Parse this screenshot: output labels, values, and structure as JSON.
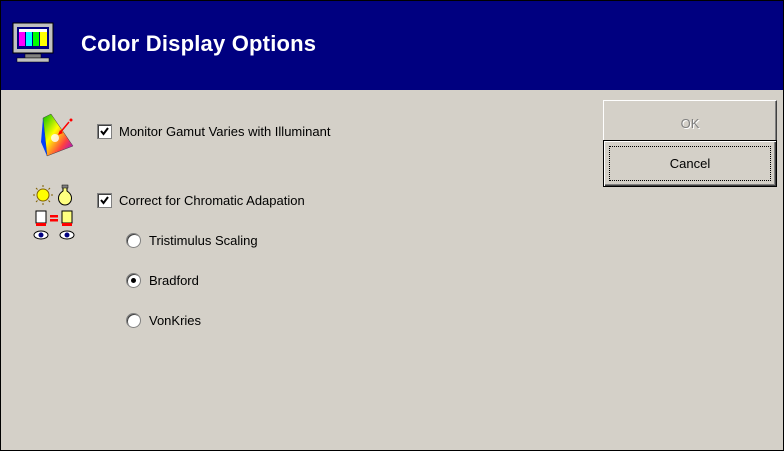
{
  "window": {
    "title": "Color Display Options"
  },
  "options": {
    "monitor_gamut": {
      "label": "Monitor Gamut Varies with Illuminant",
      "checked": true
    },
    "chromatic_adaptation": {
      "label": "Correct for Chromatic Adapation",
      "checked": true
    },
    "methods": [
      {
        "label": "Tristimulus Scaling",
        "selected": false
      },
      {
        "label": "Bradford",
        "selected": true
      },
      {
        "label": "VonKries",
        "selected": false
      }
    ]
  },
  "buttons": {
    "ok_label": "OK",
    "cancel_label": "Cancel"
  },
  "icons": {
    "title": "monitor-icon",
    "gamut": "chromaticity-diagram-icon",
    "adaptation": "chromatic-adaptation-icon"
  },
  "colors": {
    "titlebar": "#000080",
    "dialog_bg": "#d4d0c8"
  }
}
